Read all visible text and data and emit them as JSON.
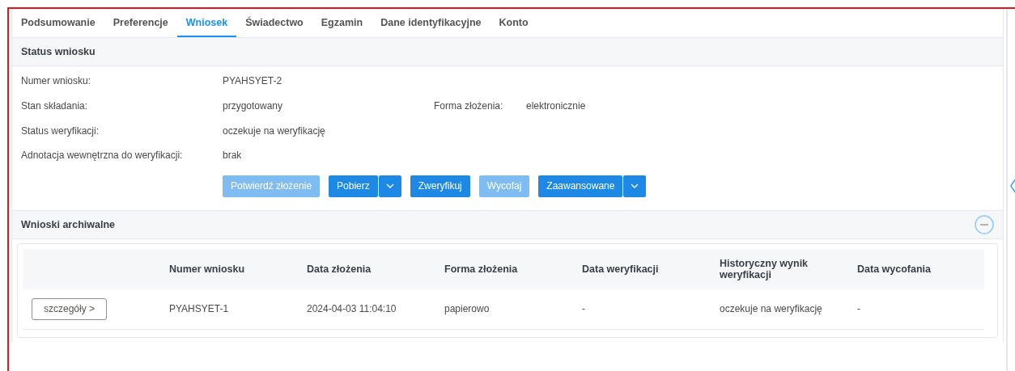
{
  "tabs": [
    {
      "label": "Podsumowanie",
      "selected": false
    },
    {
      "label": "Preferencje",
      "selected": false
    },
    {
      "label": "Wniosek",
      "selected": true
    },
    {
      "label": "Świadectwo",
      "selected": false
    },
    {
      "label": "Egzamin",
      "selected": false
    },
    {
      "label": "Dane identyfikacyjne",
      "selected": false
    },
    {
      "label": "Konto",
      "selected": false
    }
  ],
  "status_section": {
    "title": "Status wniosku",
    "rows": [
      {
        "fields": [
          {
            "label": "Numer wniosku:",
            "value": "PYAHSYET-2"
          }
        ]
      },
      {
        "fields": [
          {
            "label": "Stan składania:",
            "value": "przygotowany"
          },
          {
            "label": "Forma złożenia:",
            "value": "elektronicznie"
          }
        ]
      },
      {
        "fields": [
          {
            "label": "Status weryfikacji:",
            "value": "oczekuje na weryfikację"
          }
        ]
      },
      {
        "fields": [
          {
            "label": "Adnotacja wewnętrzna do weryfikacji:",
            "value": "brak"
          }
        ]
      }
    ],
    "buttons": [
      {
        "label": "Potwierdź złożenie",
        "disabled": true,
        "dropdown": false
      },
      {
        "label": "Pobierz",
        "disabled": false,
        "dropdown": true
      },
      {
        "label": "Zweryfikuj",
        "disabled": false,
        "dropdown": false
      },
      {
        "label": "Wycofaj",
        "disabled": true,
        "dropdown": false
      },
      {
        "label": "Zaawansowane",
        "disabled": false,
        "dropdown": true
      }
    ]
  },
  "archive_section": {
    "title": "Wnioski archiwalne",
    "expanded": true,
    "table": {
      "columns": [
        "Numer wniosku",
        "Data złożenia",
        "Forma złożenia",
        "Data weryfikacji",
        "Historyczny wynik weryfikacji",
        "Data wycofania"
      ],
      "rows": [
        {
          "action": "szczegóły >",
          "cells": [
            "PYAHSYET-1",
            "2024-04-03 11:04:10",
            "papierowo",
            "-",
            "oczekuje na weryfikację",
            "-"
          ]
        }
      ]
    }
  }
}
